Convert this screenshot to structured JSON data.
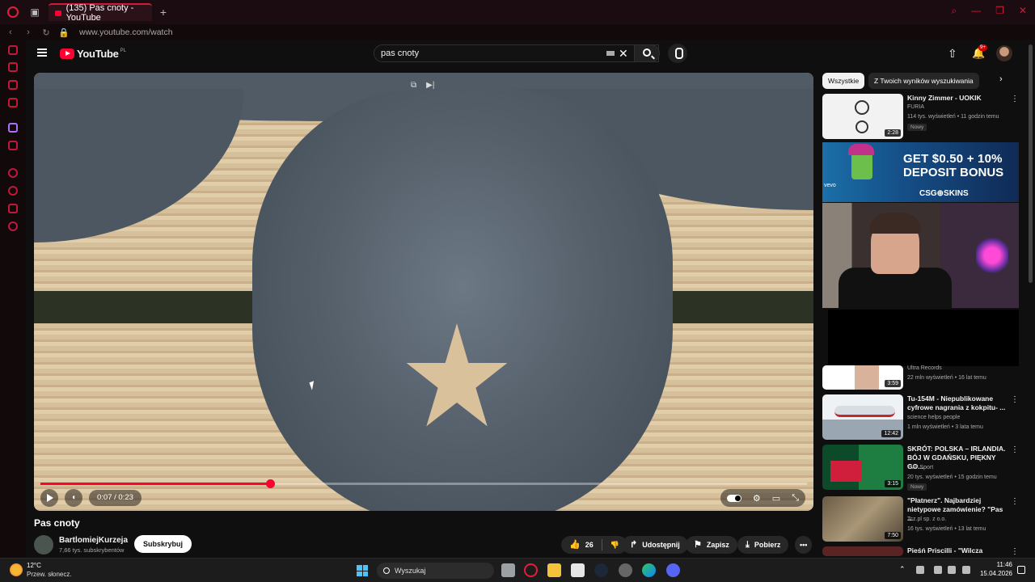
{
  "browser": {
    "tab_title": "(135) Pas cnoty - YouTube",
    "url": "www.youtube.com/watch"
  },
  "header": {
    "logo_text": "YouTube",
    "logo_region": "PL",
    "search_value": "pas cnoty",
    "notification_count": "9+"
  },
  "player": {
    "time": "0:07 / 0:23",
    "progress_fraction": 0.3,
    "colors": {
      "progress": "#ff0033"
    }
  },
  "video": {
    "title": "Pas cnoty",
    "channel": "BartlomiejKurzeja",
    "subscribers": "7,66 tys. subskrybentów",
    "subscribe_label": "Subskrybuj",
    "likes": "26",
    "share_label": "Udostępnij",
    "save_label": "Zapisz",
    "download_label": "Pobierz"
  },
  "sidebar": {
    "chips": [
      "Wszystkie",
      "Z Twoich wyników wyszukiwania"
    ],
    "recs": [
      {
        "title": "Kinny Zimmer - UOKIK",
        "channel": "FURIA",
        "meta": "114 tys. wyświetleń • 11 godzin temu",
        "badge": "Nowy",
        "duration": "2:28"
      },
      {
        "title": "",
        "channel": "Ultra Records",
        "meta": "22 mln wyświetleń • 16 lat temu",
        "badge": "",
        "duration": "3:59"
      },
      {
        "title": "Tu-154M - Niepublikowane cyfrowe nagrania z kokpitu- ...",
        "channel": "science helps people",
        "meta": "1 mln wyświetleń • 3 lata temu",
        "badge": "",
        "duration": "12:42"
      },
      {
        "title": "SKRÓT: POLSKA – IRLANDIA. BÓJ W GDAŃSKU, PIĘKNY GO...",
        "channel": "TVP Sport",
        "meta": "20 tys. wyświetleń • 15 godzin temu",
        "badge": "Nowy",
        "duration": "3:15"
      },
      {
        "title": "\"Płatnerz\". Najbardziej nietypowe zamówienie? \"Pas ...",
        "channel": "Tcz.pl sp. z o.o.",
        "meta": "16 tys. wyświetleń • 13 lat temu",
        "badge": "",
        "duration": "7:50"
      },
      {
        "title": "Pieśń Priscilli - \"Wilcza Zamieć\"",
        "channel": "",
        "meta": "",
        "badge": "",
        "duration": ""
      }
    ],
    "ad": {
      "line1": "GET $0.50 + 10%",
      "line2": "DEPOSIT BONUS",
      "brand": "CSG⊕SKINS",
      "tag": "vevo"
    }
  },
  "taskbar": {
    "temperature": "12°C",
    "weather": "Przew. słonecz.",
    "search_label": "Wyszukaj",
    "time": "11:46",
    "date": "15.04.2026"
  }
}
